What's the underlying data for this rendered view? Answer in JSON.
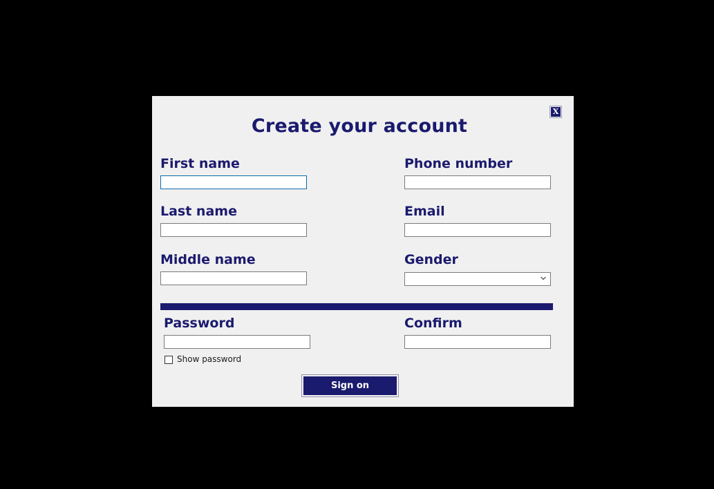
{
  "dialog": {
    "title": "Create your account",
    "close_label": "X"
  },
  "fields": {
    "first_name": {
      "label": "First name",
      "value": ""
    },
    "last_name": {
      "label": "Last name",
      "value": ""
    },
    "middle_name": {
      "label": "Middle name",
      "value": ""
    },
    "phone_number": {
      "label": "Phone number",
      "value": ""
    },
    "email": {
      "label": "Email",
      "value": ""
    },
    "gender": {
      "label": "Gender",
      "selected": ""
    },
    "password": {
      "label": "Password",
      "value": ""
    },
    "confirm": {
      "label": "Confirm",
      "value": ""
    }
  },
  "show_password": {
    "label": "Show password",
    "checked": false
  },
  "sign_on_button": {
    "label": "Sign on"
  },
  "colors": {
    "accent": "#1a1a6e",
    "dialog_bg": "#f0f0f0",
    "backdrop": "#000000",
    "focus_border": "#0b6aa8"
  },
  "icons": {
    "gender_dropdown": "chevron-down-icon"
  }
}
